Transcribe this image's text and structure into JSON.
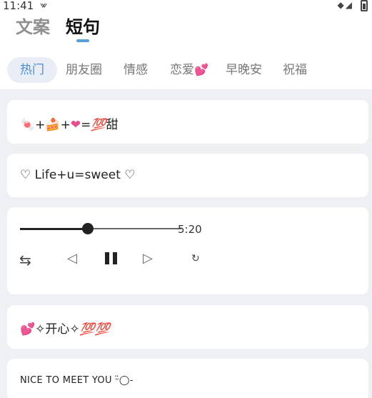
{
  "status": {
    "time": "11:41"
  },
  "tabs": {
    "tab1": "文案",
    "tab2": "短句"
  },
  "categories": [
    "热门",
    "朋友圈",
    "情感",
    "恋爱",
    "早晚安",
    "祝福"
  ],
  "cards": [
    {
      "parts": [
        "+",
        "+",
        "=",
        "💯",
        "甜"
      ]
    },
    {
      "text": "♡ Life+u=sweet ♡"
    },
    {
      "player": {
        "duration": "5:20",
        "progress": 0.42
      }
    },
    {
      "parts": [
        "✧开心✧",
        "💯💯"
      ]
    },
    {
      "text": "NICE TO MEET YOU ᵕ̈◯-"
    }
  ],
  "icons": {
    "signal": "wifi-and-signal-icon",
    "battery": "battery-icon",
    "shuffle": "shuffle-icon",
    "prev": "previous-icon",
    "pause": "pause-icon",
    "next": "next-icon",
    "repeat": "repeat-icon"
  },
  "colors": {
    "accent": "#4a8ed6",
    "heart": "#e64d8a",
    "hundred": "#e23b3b"
  }
}
